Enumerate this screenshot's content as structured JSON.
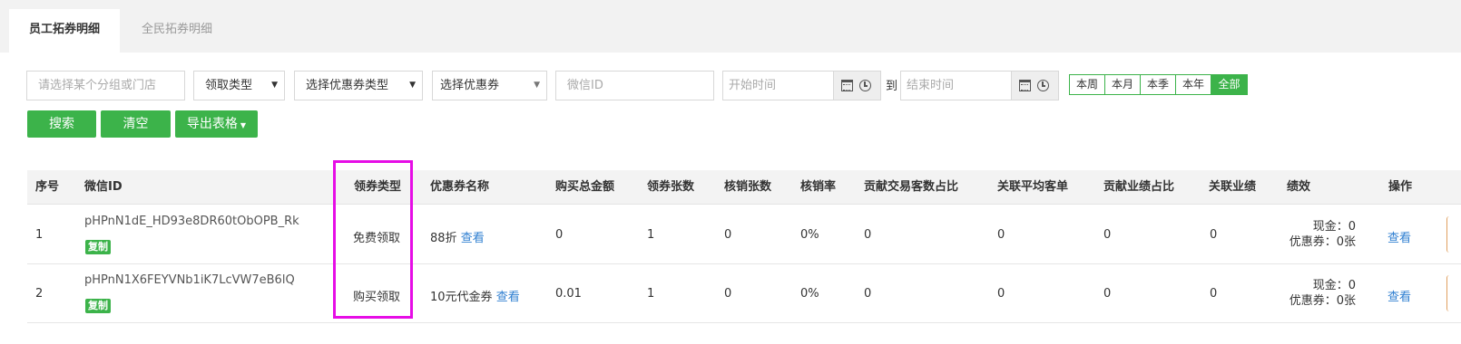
{
  "tabs": [
    {
      "label": "员工拓券明细",
      "active": true
    },
    {
      "label": "全民拓券明细",
      "active": false
    }
  ],
  "filters": {
    "group_store": {
      "placeholder": "请选择某个分组或门店"
    },
    "claim_type": {
      "value": "领取类型"
    },
    "coupon_type": {
      "value": "选择优惠券类型"
    },
    "coupon": {
      "value": "选择优惠券"
    },
    "wechat_id": {
      "placeholder": "微信ID"
    },
    "start_time": {
      "placeholder": "开始时间"
    },
    "to_label": "到",
    "end_time": {
      "placeholder": "结束时间"
    },
    "ranges": [
      {
        "label": "本周",
        "active": false
      },
      {
        "label": "本月",
        "active": false
      },
      {
        "label": "本季",
        "active": false
      },
      {
        "label": "本年",
        "active": false
      },
      {
        "label": "全部",
        "active": true
      }
    ]
  },
  "actions": {
    "search": "搜索",
    "clear": "清空",
    "export": "导出表格"
  },
  "table": {
    "columns": [
      "序号",
      "微信ID",
      "领券类型",
      "优惠券名称",
      "购买总金额",
      "领券张数",
      "核销张数",
      "核销率",
      "贡献交易客数占比",
      "关联平均客单",
      "贡献业绩占比",
      "关联业绩",
      "绩效",
      "操作"
    ],
    "rows": [
      {
        "index": "1",
        "wechat_id": "pHPnN1dE_HD93e8DR60tObOPB_Rk",
        "copy": "复制",
        "claim_type": "免费领取",
        "coupon_name": "88折",
        "coupon_view": "查看",
        "total_amount": "0",
        "claimed": "1",
        "redeemed": "0",
        "rate": "0%",
        "customer_share": "0",
        "avg_order": "0",
        "revenue_share": "0",
        "related_revenue": "0",
        "perf_cash": "现金：0",
        "perf_coupon": "优惠券：0张",
        "op": "查看"
      },
      {
        "index": "2",
        "wechat_id": "pHPnN1X6FEYVNb1iK7LcVW7eB6lQ",
        "copy": "复制",
        "claim_type": "购买领取",
        "coupon_name": "10元代金券",
        "coupon_view": "查看",
        "total_amount": "0.01",
        "claimed": "1",
        "redeemed": "0",
        "rate": "0%",
        "customer_share": "0",
        "avg_order": "0",
        "revenue_share": "0",
        "related_revenue": "0",
        "perf_cash": "现金：0",
        "perf_coupon": "优惠券：0张",
        "op": "查看"
      }
    ]
  },
  "colors": {
    "accent_green": "#3cb34a",
    "link_blue": "#2f7fd1",
    "highlight_magenta": "#e60de6"
  }
}
